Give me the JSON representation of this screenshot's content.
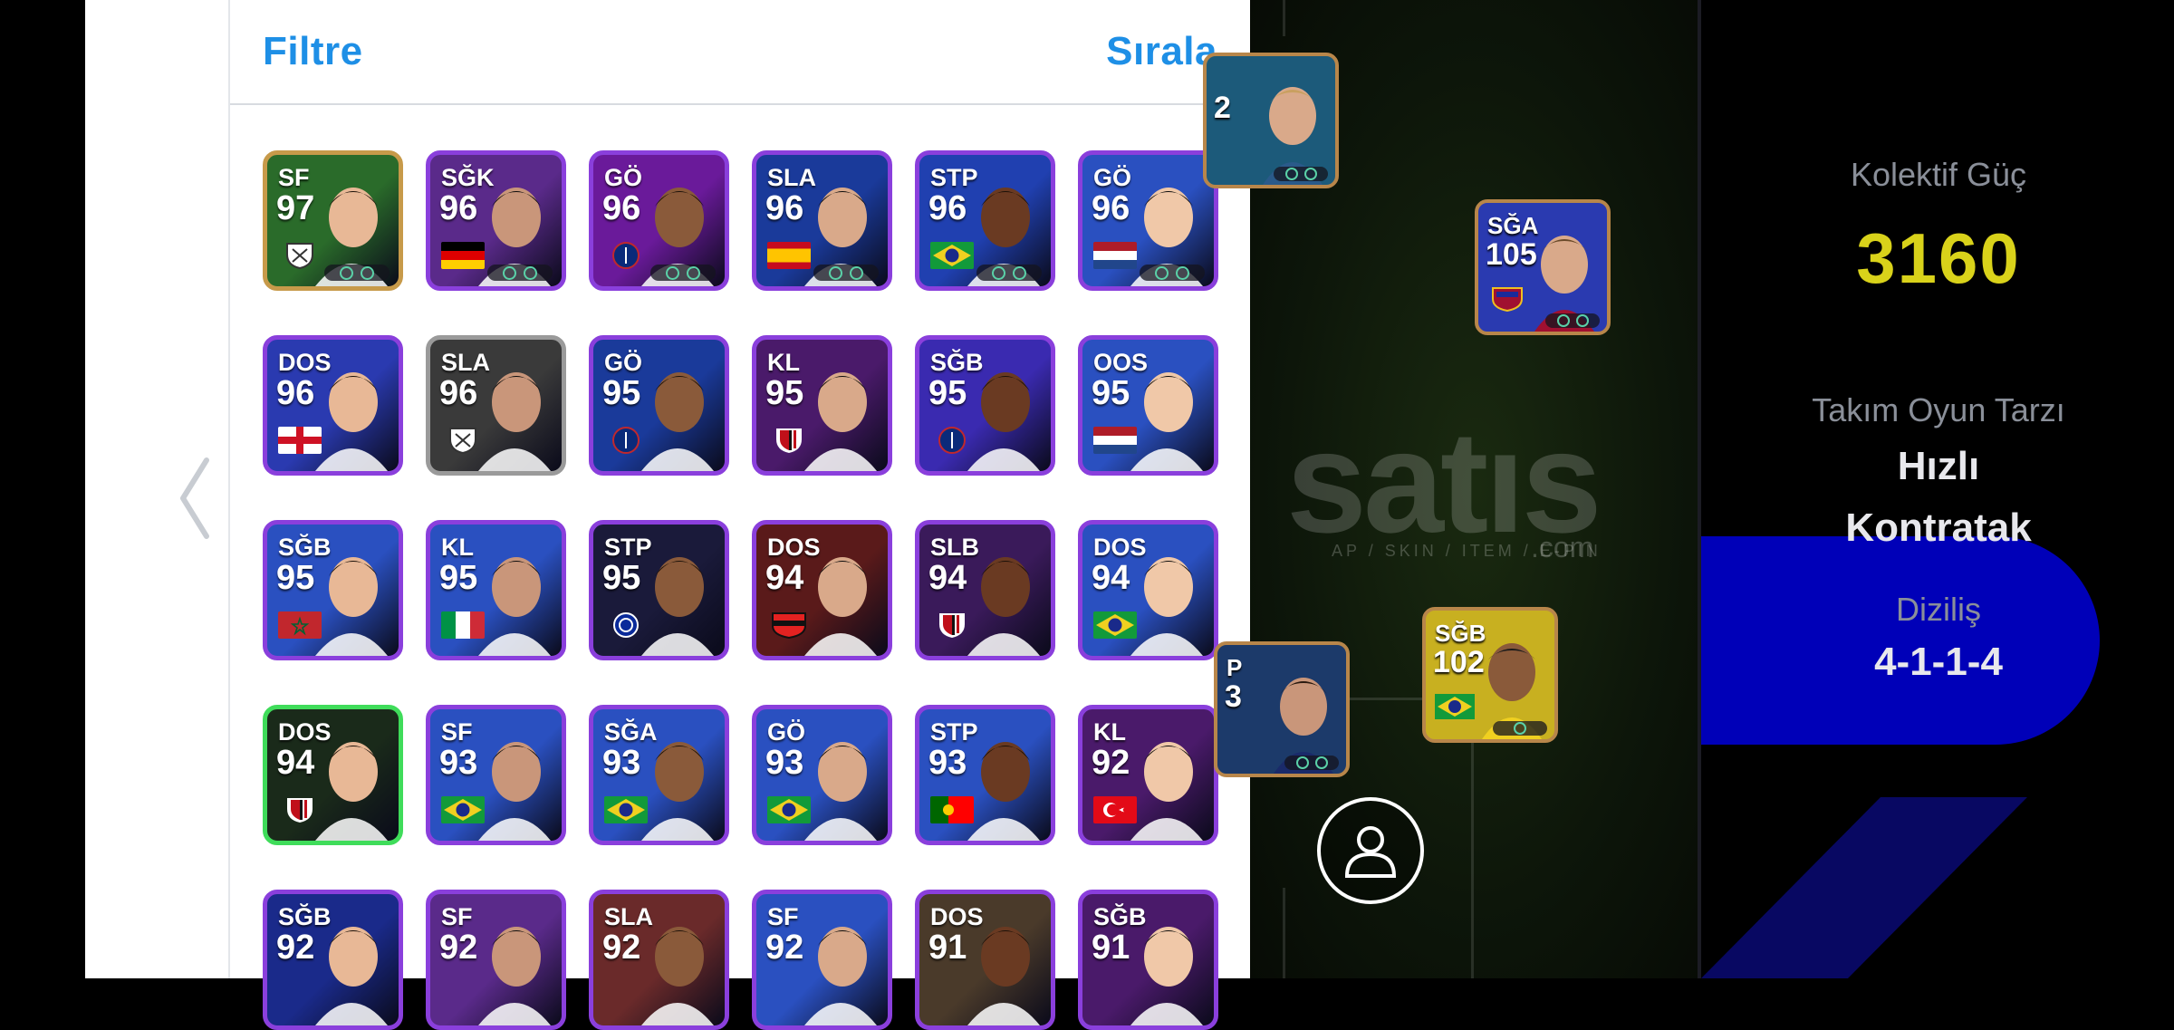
{
  "list_header": {
    "filter_label": "Filtre",
    "sort_label": "Sırala"
  },
  "players": [
    {
      "pos": "SF",
      "rating": "97",
      "theme": "#2a6b2a",
      "border": "#c79a4a",
      "flag": "club-white"
    },
    {
      "pos": "SĞK",
      "rating": "96",
      "theme": "#5a2a8a",
      "border": "#8a3fdc",
      "flag": "germany"
    },
    {
      "pos": "GÖ",
      "rating": "96",
      "theme": "#6a1a9a",
      "border": "#8a3fdc",
      "flag": "psg"
    },
    {
      "pos": "SLA",
      "rating": "96",
      "theme": "#1a3a9a",
      "border": "#8a3fdc",
      "flag": "spain"
    },
    {
      "pos": "STP",
      "rating": "96",
      "theme": "#2040b0",
      "border": "#8a3fdc",
      "flag": "brazil"
    },
    {
      "pos": "GÖ",
      "rating": "96",
      "theme": "#2a50c0",
      "border": "#8a3fdc",
      "flag": "netherlands"
    },
    {
      "pos": "DOS",
      "rating": "96",
      "theme": "#2a3ab0",
      "border": "#8a3fdc",
      "flag": "england"
    },
    {
      "pos": "SLA",
      "rating": "96",
      "theme": "#3a3a3a",
      "border": "#9a9a9a",
      "flag": "club-white"
    },
    {
      "pos": "GÖ",
      "rating": "95",
      "theme": "#1a3a9a",
      "border": "#8a3fdc",
      "flag": "psg"
    },
    {
      "pos": "KL",
      "rating": "95",
      "theme": "#4a1a6a",
      "border": "#8a3fdc",
      "flag": "milan"
    },
    {
      "pos": "SĞB",
      "rating": "95",
      "theme": "#3a2ab0",
      "border": "#8a3fdc",
      "flag": "psg"
    },
    {
      "pos": "OOS",
      "rating": "95",
      "theme": "#2a50c0",
      "border": "#8a3fdc",
      "flag": "netherlands"
    },
    {
      "pos": "SĞB",
      "rating": "95",
      "theme": "#2a50c0",
      "border": "#8a3fdc",
      "flag": "morocco"
    },
    {
      "pos": "KL",
      "rating": "95",
      "theme": "#2a50c0",
      "border": "#8a3fdc",
      "flag": "italy"
    },
    {
      "pos": "STP",
      "rating": "95",
      "theme": "#1a1a3a",
      "border": "#8a3fdc",
      "flag": "inter"
    },
    {
      "pos": "DOS",
      "rating": "94",
      "theme": "#5a1a1a",
      "border": "#8a3fdc",
      "flag": "leverkusen"
    },
    {
      "pos": "SLB",
      "rating": "94",
      "theme": "#3a1a5a",
      "border": "#8a3fdc",
      "flag": "milan"
    },
    {
      "pos": "DOS",
      "rating": "94",
      "theme": "#2a50c0",
      "border": "#8a3fdc",
      "flag": "brazil"
    },
    {
      "pos": "DOS",
      "rating": "94",
      "theme": "#1a2a1a",
      "border": "#3fdc5a",
      "flag": "milan"
    },
    {
      "pos": "SF",
      "rating": "93",
      "theme": "#2a50c0",
      "border": "#8a3fdc",
      "flag": "brazil"
    },
    {
      "pos": "SĞA",
      "rating": "93",
      "theme": "#2a50c0",
      "border": "#8a3fdc",
      "flag": "brazil"
    },
    {
      "pos": "GÖ",
      "rating": "93",
      "theme": "#2a50c0",
      "border": "#8a3fdc",
      "flag": "brazil"
    },
    {
      "pos": "STP",
      "rating": "93",
      "theme": "#2a50c0",
      "border": "#8a3fdc",
      "flag": "portugal"
    },
    {
      "pos": "KL",
      "rating": "92",
      "theme": "#4a1a6a",
      "border": "#8a3fdc",
      "flag": "turkey"
    },
    {
      "pos": "SĞB",
      "rating": "92",
      "theme": "#1a2a8a",
      "border": "#8a3fdc",
      "flag": "none"
    },
    {
      "pos": "SF",
      "rating": "92",
      "theme": "#5a2a8a",
      "border": "#8a3fdc",
      "flag": "none"
    },
    {
      "pos": "SLA",
      "rating": "92",
      "theme": "#6a2a2a",
      "border": "#8a3fdc",
      "flag": "none"
    },
    {
      "pos": "SF",
      "rating": "92",
      "theme": "#2a50c0",
      "border": "#8a3fdc",
      "flag": "none"
    },
    {
      "pos": "DOS",
      "rating": "91",
      "theme": "#4a3a2a",
      "border": "#8a3fdc",
      "flag": "none"
    },
    {
      "pos": "SĞB",
      "rating": "91",
      "theme": "#4a1a6a",
      "border": "#8a3fdc",
      "flag": "none"
    }
  ],
  "field": {
    "watermark": "satıs",
    "watermark_sub": "AP / SKIN / ITEM / E-PIN",
    "watermark_com": ".com",
    "slots": [
      {
        "pos": "",
        "rating": "2",
        "flag": "none"
      },
      {
        "pos": "SĞA",
        "rating": "105",
        "flag": "barcelona"
      },
      {
        "pos": "P",
        "rating": "3",
        "flag": "none"
      },
      {
        "pos": "SĞB",
        "rating": "102",
        "flag": "brazil"
      }
    ]
  },
  "stats": {
    "collective_label": "Kolektif Güç",
    "collective_value": "3160",
    "style_label": "Takım Oyun Tarzı",
    "style_value_1": "Hızlı",
    "style_value_2": "Kontratak",
    "formation_label": "Diziliş",
    "formation_value": "4-1-1-4"
  },
  "colors": {
    "accent": "#1e8fe6",
    "collective": "#d9d21a",
    "formation_bg": "#0000b8"
  },
  "icons": {
    "back": "chevron-left-icon",
    "user": "user-icon"
  }
}
